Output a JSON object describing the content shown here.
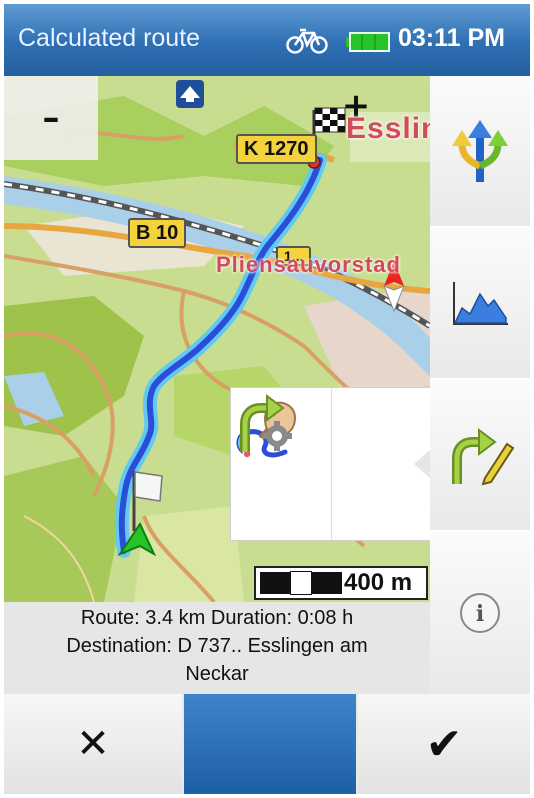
{
  "status_bar": {
    "title": "Calculated route",
    "time": "03:11 PM",
    "profile_icon": "bicycle-icon",
    "battery_icon": "battery-full-icon"
  },
  "map": {
    "zoom_out_label": "–",
    "zoom_in_label": "+",
    "road_labels": [
      "K 1270",
      "B 10",
      "1..."
    ],
    "place_labels": [
      "Essling",
      "Pliensauvorstad"
    ],
    "scale_label": "400 m"
  },
  "route_info": {
    "line1": "Route: 3.4 km Duration: 0:08 h",
    "line2": "Destination: D 737.. Esslingen am",
    "line3": "Neckar"
  },
  "side_panel": {
    "buttons": [
      "route-alternatives-icon",
      "elevation-profile-icon",
      "edit-route-icon",
      "info-icon"
    ],
    "info_glyph": "i"
  },
  "popup": {
    "buttons": [
      "draw-route-icon",
      "route-settings-icon"
    ]
  },
  "bottom_bar": {
    "cancel_glyph": "✕",
    "confirm_glyph": "✔"
  },
  "colors": {
    "status_bar": "#2e6fb3",
    "route": "#2a4fd6",
    "route_halo": "#62c9f3",
    "battery": "#27c427",
    "middle_button": "#2b6db3"
  }
}
